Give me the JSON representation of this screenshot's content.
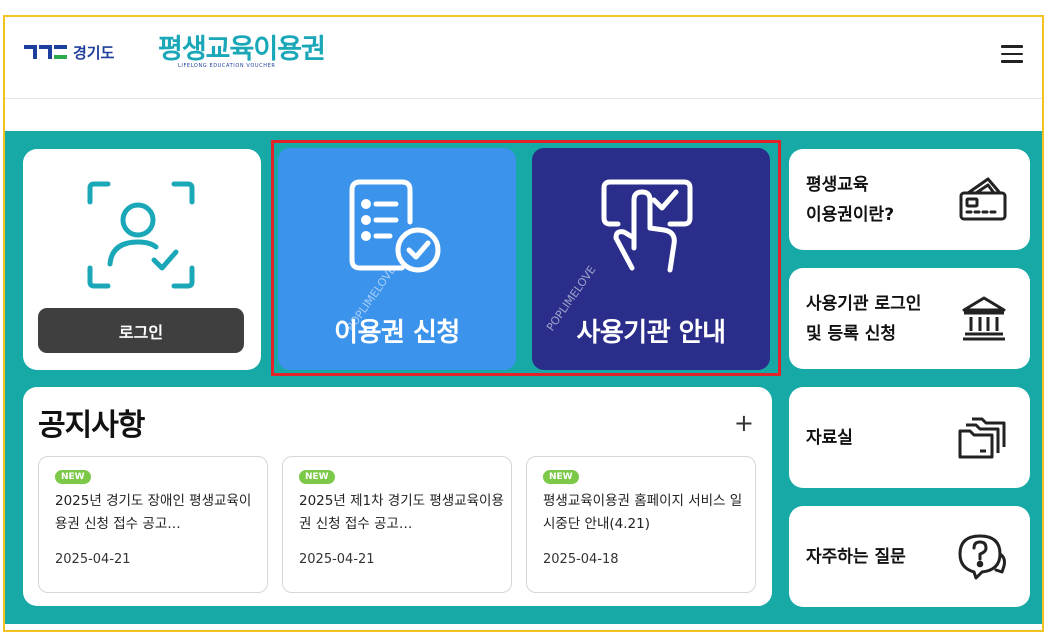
{
  "header": {
    "gov_logo_text": "경기도",
    "service_logo_title": "평생교육이용권",
    "service_logo_subtitle": "LIFELONG EDUCATION VOUCHER",
    "menu_icon": "hamburger-menu-icon"
  },
  "login": {
    "icon": "face-scan-check-icon",
    "button_label": "로그인"
  },
  "tiles": {
    "apply": {
      "label": "이용권 신청",
      "icon": "document-check-icon",
      "color": "#3b93ec"
    },
    "guide": {
      "label": "사용기관 안내",
      "icon": "touch-check-icon",
      "color": "#2a2e8a"
    },
    "watermark": "POPLIMELOVE"
  },
  "side_menu": [
    {
      "line1": "평생교육",
      "line2": "이용권이란?",
      "icon": "voucher-card-icon"
    },
    {
      "line1": "사용기관 로그인",
      "line2": "및 등록 신청",
      "icon": "institution-building-icon"
    },
    {
      "line1": "자료실",
      "line2": "",
      "icon": "folders-icon"
    },
    {
      "line1": "자주하는 질문",
      "line2": "",
      "icon": "question-chat-icon"
    }
  ],
  "notices": {
    "title": "공지사항",
    "more_label": "+",
    "items": [
      {
        "badge": "NEW",
        "text": "2025년 경기도 장애인 평생교육이용권 신청 접수 공고…",
        "date": "2025-04-21"
      },
      {
        "badge": "NEW",
        "text": "2025년 제1차 경기도 평생교육이용권 신청 접수 공고…",
        "date": "2025-04-21"
      },
      {
        "badge": "NEW",
        "text": "평생교육이용권 홈페이지 서비스 일시중단 안내(4.21)",
        "date": "2025-04-18"
      }
    ]
  },
  "colors": {
    "accent_teal": "#17a9a6",
    "highlight_border": "#e0242a",
    "outer_border": "#f2c21f"
  }
}
